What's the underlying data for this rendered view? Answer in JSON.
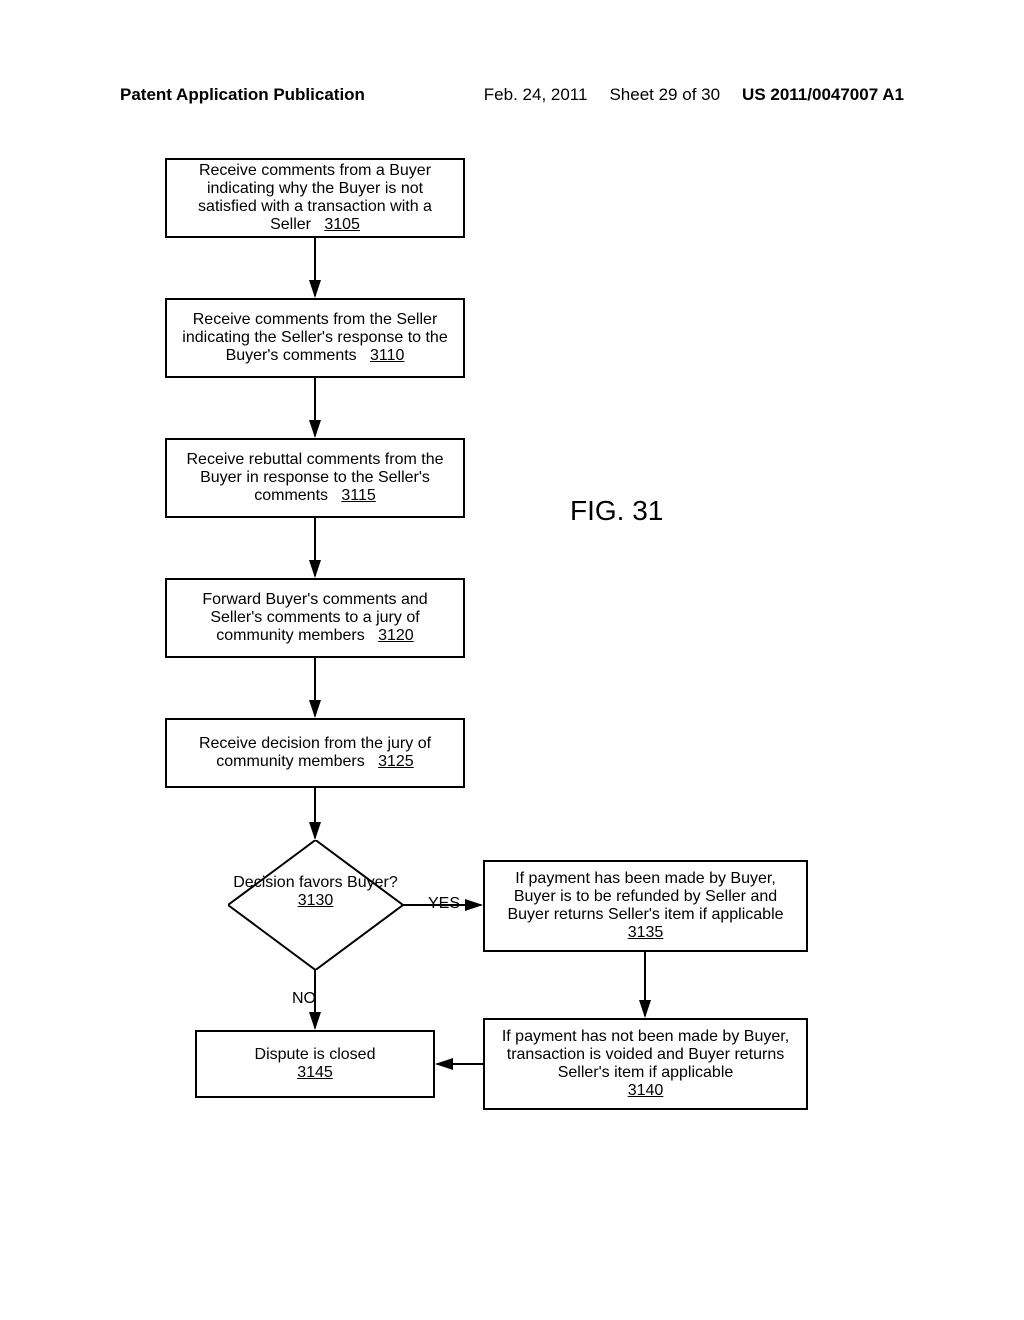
{
  "header": {
    "publication": "Patent Application Publication",
    "date": "Feb. 24, 2011",
    "sheet": "Sheet 29 of 30",
    "docnum": "US 2011/0047007 A1"
  },
  "figure_label": "FIG. 31",
  "boxes": {
    "b3105": {
      "text": "Receive comments from a Buyer indicating why the Buyer is not satisfied with a transaction with a Seller",
      "ref": "3105"
    },
    "b3110": {
      "text": "Receive comments from the Seller indicating the Seller's response to the Buyer's comments",
      "ref": "3110"
    },
    "b3115": {
      "text": "Receive rebuttal comments from the Buyer in response to the Seller's comments",
      "ref": "3115"
    },
    "b3120": {
      "text": "Forward Buyer's comments and Seller's comments to a jury of community members",
      "ref": "3120"
    },
    "b3125": {
      "text": "Receive decision from the jury of community members",
      "ref": "3125"
    },
    "b3135": {
      "text": "If payment has been made by Buyer, Buyer is to be refunded by Seller and Buyer returns Seller's item if applicable",
      "ref": "3135"
    },
    "b3140": {
      "text": "If payment has not been made by Buyer, transaction is voided and Buyer returns Seller's item if applicable",
      "ref": "3140"
    },
    "b3145": {
      "text": "Dispute is closed",
      "ref": "3145"
    }
  },
  "decision": {
    "text": "Decision favors Buyer?",
    "ref": "3130",
    "yes": "YES",
    "no": "NO"
  }
}
